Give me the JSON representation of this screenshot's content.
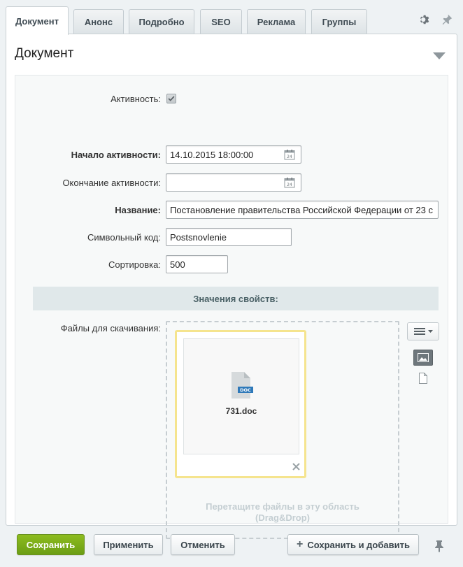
{
  "tabs": [
    {
      "label": "Документ",
      "active": true
    },
    {
      "label": "Анонс"
    },
    {
      "label": "Подробно"
    },
    {
      "label": "SEO"
    },
    {
      "label": "Реклама"
    },
    {
      "label": "Группы"
    }
  ],
  "tab_tools": {
    "settings_icon": "gear-icon",
    "pin_icon": "pin-icon"
  },
  "section": {
    "title": "Документ",
    "collapse_icon": "chevron-down-icon"
  },
  "form": {
    "active_label": "Активность:",
    "active_checked": true,
    "active_from_label": "Начало активности:",
    "active_from_value": "14.10.2015 18:00:00",
    "active_to_label": "Окончание активности:",
    "active_to_value": "",
    "name_label": "Название:",
    "name_value": "Постановление правительства Российской Федерации от 23 с",
    "code_label": "Символьный код:",
    "code_value": "Postsnovlenie",
    "sort_label": "Сортировка:",
    "sort_value": "500"
  },
  "properties": {
    "header": "Значения свойств:",
    "files_label": "Файлы для скачивания:",
    "file": {
      "name": "731.doc",
      "icon": "doc-file-icon",
      "badge": "DOC"
    },
    "drop_hint_line1": "Перетащите файлы в эту область",
    "drop_hint_line2": "(Drag&Drop)"
  },
  "buttons": {
    "save": "Сохранить",
    "apply": "Применить",
    "cancel": "Отменить",
    "save_add": "Сохранить и добавить"
  },
  "colors": {
    "save_button": "#79aa17",
    "file_highlight": "#f5e48e"
  }
}
